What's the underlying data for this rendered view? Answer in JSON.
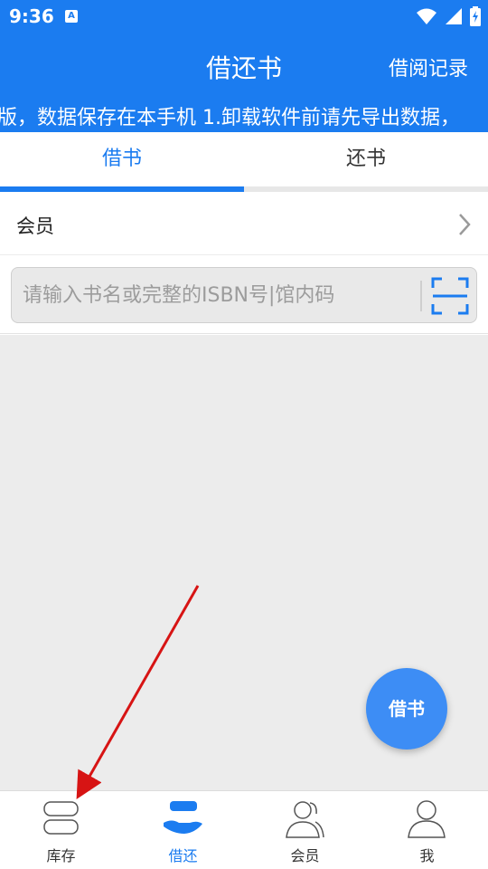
{
  "status_bar": {
    "time": "9:36",
    "badge": "A",
    "icons": [
      "wifi-icon",
      "signal-icon",
      "battery-icon"
    ]
  },
  "header": {
    "title": "借还书",
    "history_label": "借阅记录"
  },
  "marquee": {
    "text": "版，数据保存在本手机   1.卸载软件前请先导出数据，"
  },
  "tabs": [
    {
      "label": "借书",
      "active": true
    },
    {
      "label": "还书",
      "active": false
    }
  ],
  "member": {
    "label": "会员"
  },
  "search": {
    "placeholder": "请输入书名或完整的ISBN号|馆内码",
    "value": ""
  },
  "fab": {
    "label": "借书"
  },
  "bottom_nav": [
    {
      "label": "库存",
      "icon": "books-icon",
      "active": false
    },
    {
      "label": "借还",
      "icon": "lend-return-icon",
      "active": true
    },
    {
      "label": "会员",
      "icon": "members-icon",
      "active": false
    },
    {
      "label": "我",
      "icon": "person-icon",
      "active": false
    }
  ],
  "colors": {
    "primary": "#1b7cf0",
    "fab": "#3d8df5",
    "content_bg": "#ececec",
    "annotation_arrow": "#d71414"
  }
}
